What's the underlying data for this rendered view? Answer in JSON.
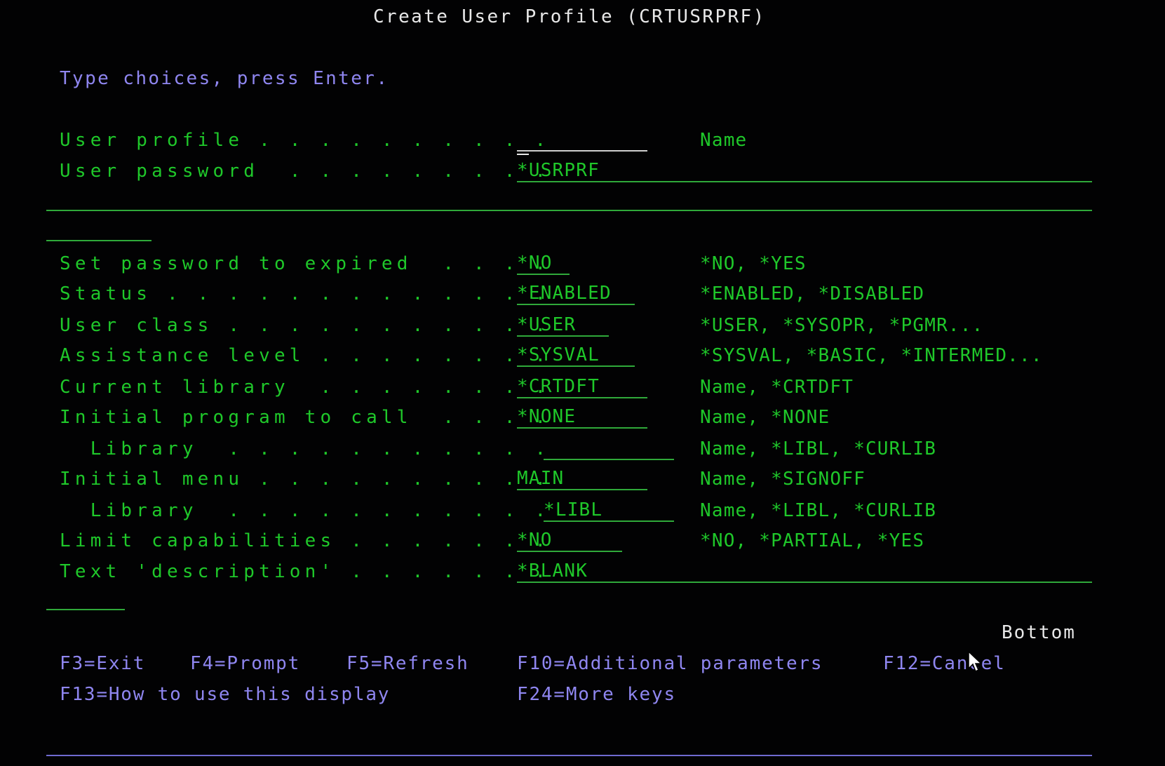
{
  "screen": {
    "title": "Create User Profile (CRTUSRPRF)",
    "instruction": "Type choices, press Enter.",
    "scroll_indicator": "Bottom"
  },
  "fields": [
    {
      "label": "User profile . . . . . . . . . .",
      "value": "",
      "hint": "Name"
    },
    {
      "label": "User password  . . . . . . . . .",
      "value": "*USRPRF",
      "hint": ""
    },
    {
      "label": "Set password to expired  . . . .",
      "value": "*NO",
      "hint": "*NO, *YES"
    },
    {
      "label": "Status . . . . . . . . . . . . .",
      "value": "*ENABLED",
      "hint": "*ENABLED, *DISABLED"
    },
    {
      "label": "User class . . . . . . . . . . .",
      "value": "*USER",
      "hint": "*USER, *SYSOPR, *PGMR..."
    },
    {
      "label": "Assistance level . . . . . . . .",
      "value": "*SYSVAL",
      "hint": "*SYSVAL, *BASIC, *INTERMED..."
    },
    {
      "label": "Current library  . . . . . . . .",
      "value": "*CRTDFT",
      "hint": "Name, *CRTDFT"
    },
    {
      "label": "Initial program to call  . . . .",
      "value": "*NONE",
      "hint": "Name, *NONE"
    },
    {
      "label": "  Library  . . . . . . . . . . .",
      "value": "",
      "hint": "Name, *LIBL, *CURLIB"
    },
    {
      "label": "Initial menu . . . . . . . . . .",
      "value": "MAIN",
      "hint": "Name, *SIGNOFF"
    },
    {
      "label": "  Library  . . . . . . . . . . .",
      "value": "*LIBL",
      "hint": "Name, *LIBL, *CURLIB"
    },
    {
      "label": "Limit capabilities . . . . . . .",
      "value": "*NO",
      "hint": "*NO, *PARTIAL, *YES"
    },
    {
      "label": "Text 'description' . . . . . . .",
      "value": "*BLANK",
      "hint": ""
    }
  ],
  "function_keys": {
    "row1": [
      "F3=Exit",
      "F4=Prompt",
      "F5=Refresh",
      "F10=Additional parameters",
      "F12=Cancel"
    ],
    "row2": [
      "F13=How to use this display",
      "F24=More keys"
    ]
  },
  "colors": {
    "background": "#020203",
    "title": "#e8e8e8",
    "instruction": "#8f86f0",
    "field_text": "#1fc82a",
    "underline": "#2fa93a"
  }
}
